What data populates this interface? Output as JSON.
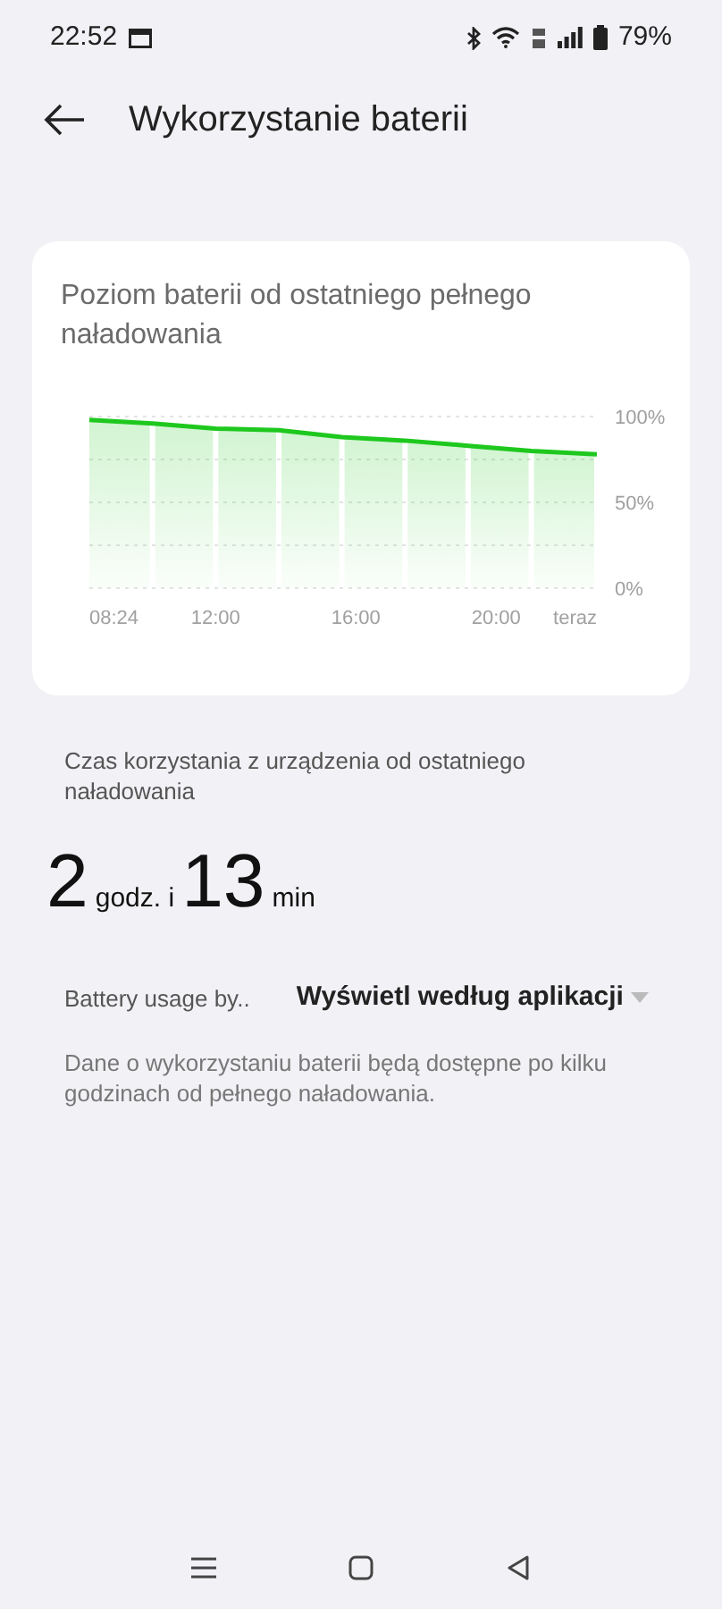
{
  "status_bar": {
    "time": "22:52",
    "battery": "79%"
  },
  "header": {
    "title": "Wykorzystanie baterii"
  },
  "battery_card": {
    "title": "Poziom baterii od ostatniego pełnego naładowania",
    "chart_data": {
      "type": "area",
      "x": [
        8.4,
        10.2,
        12,
        13.8,
        15.6,
        17.4,
        19.2,
        21,
        22.87
      ],
      "series": [
        {
          "color": "#1ec81e",
          "values": [
            98,
            96,
            93,
            92,
            88,
            86,
            83,
            80,
            78
          ]
        }
      ],
      "xlim": [
        8.4,
        22.87
      ],
      "ylim": [
        0,
        100
      ],
      "xticks": [
        {
          "value": 8.4,
          "label": "08:24"
        },
        {
          "value": 12,
          "label": "12:00"
        },
        {
          "value": 16,
          "label": "16:00"
        },
        {
          "value": 20,
          "label": "20:00"
        },
        {
          "value": 22.87,
          "label": "teraz"
        }
      ],
      "yticks": [
        {
          "value": 0,
          "label": "0%"
        },
        {
          "value": 50,
          "label": "50%"
        },
        {
          "value": 100,
          "label": "100%"
        }
      ]
    }
  },
  "usage": {
    "caption": "Czas korzystania z urządzenia od ostatniego naładowania",
    "hours": "2",
    "hours_unit": "godz. i",
    "minutes": "13",
    "minutes_unit": "min"
  },
  "filter": {
    "label": "Battery usage by..",
    "value": "Wyświetl według aplikacji"
  },
  "note": "Dane o wykorzystaniu baterii będą dostępne po kilku godzinach od pełnego naładowania."
}
